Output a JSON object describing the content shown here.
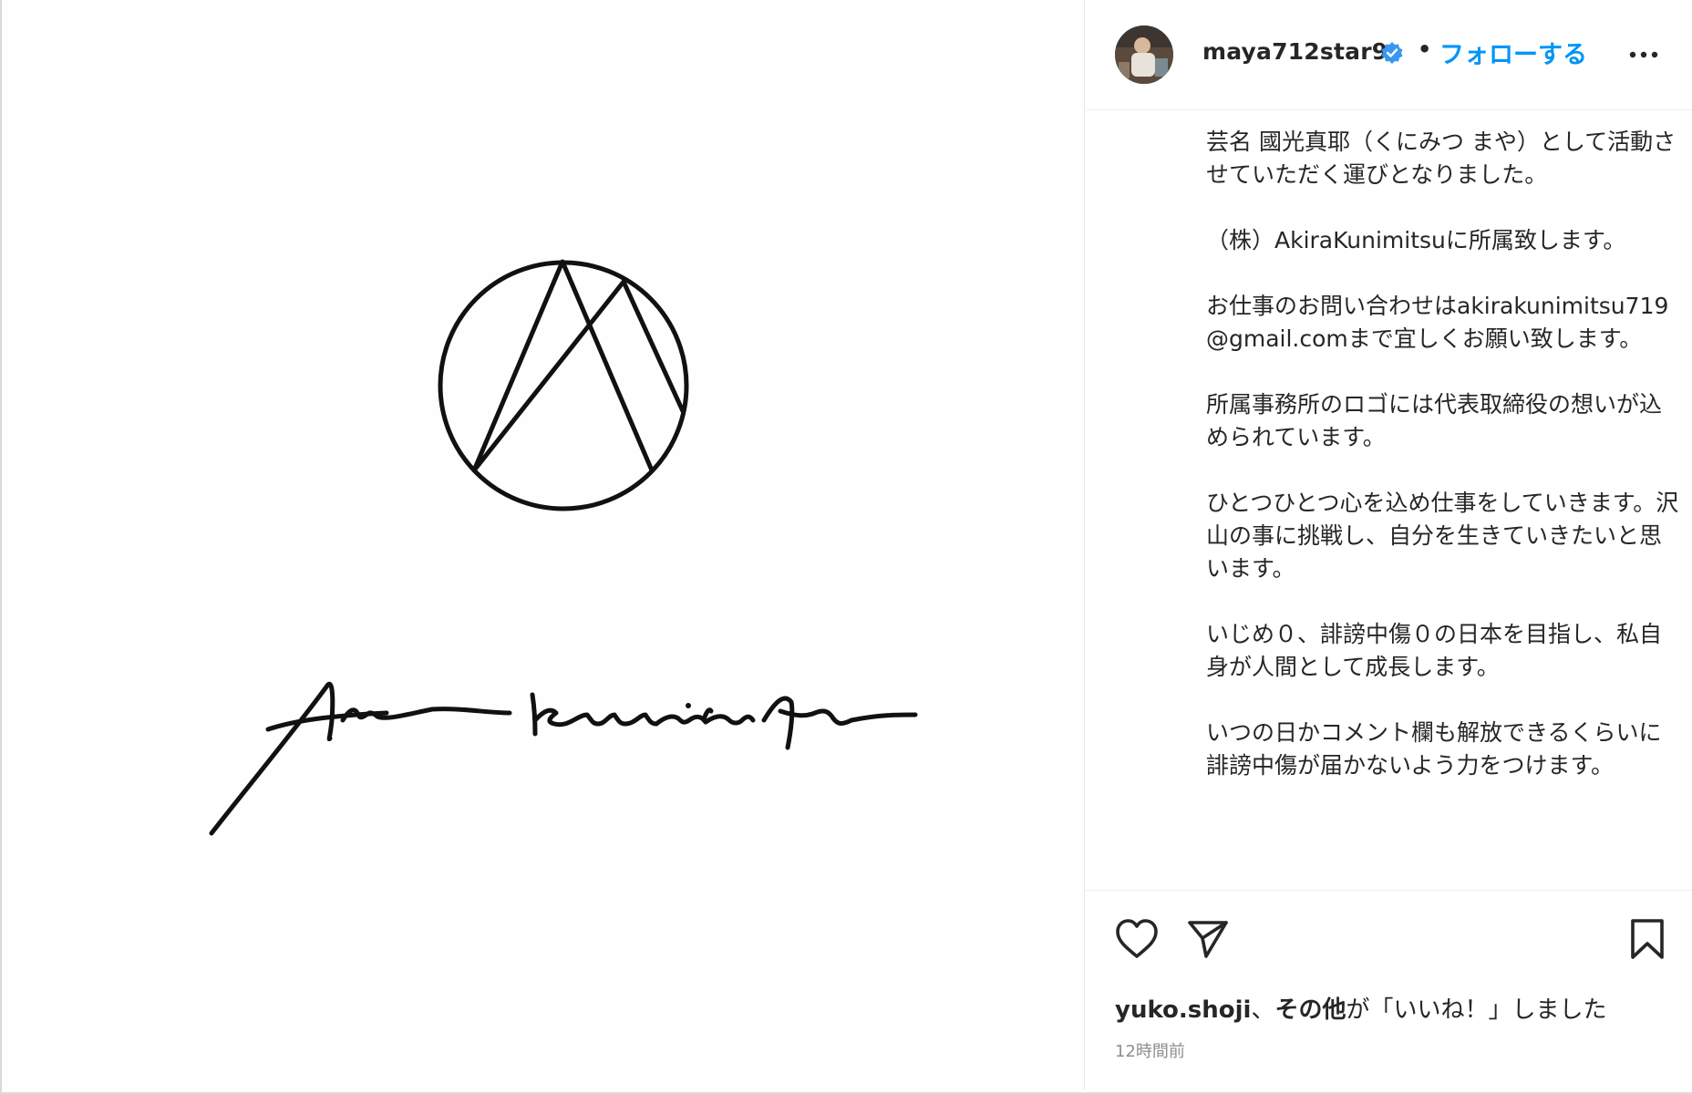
{
  "media": {
    "logo_alt": "AkiraKunimitsu logo",
    "signature_text": "Akira Kunimitsu"
  },
  "header": {
    "username": "maya712star9",
    "separator": "•",
    "follow_label": "フォローする",
    "verified_icon": "verified-badge-icon",
    "more_icon": "more-options-icon"
  },
  "caption": {
    "paragraphs": [
      "芸名 國光真耶（くにみつ まや）として活動させていただく運びとなりました。",
      "（株）AkiraKunimitsuに所属致します。",
      "お仕事のお問い合わせはakirakunimitsu719@gmail.comまで宜しくお願い致します。",
      "所属事務所のロゴには代表取締役の想いが込められています。",
      "ひとつひとつ心を込め仕事をしていきます。沢山の事に挑戦し、自分を生きていきたいと思います。",
      "いじめ０、誹謗中傷０の日本を目指し、私自身が人間として成長します。",
      "いつの日かコメント欄も解放できるくらいに誹謗中傷が届かないよう力をつけます。"
    ]
  },
  "actions": {
    "like_icon": "heart-icon",
    "share_icon": "paper-plane-icon",
    "save_icon": "bookmark-icon"
  },
  "likes": {
    "user": "yuko.shoji",
    "sep": "、",
    "others": "その他",
    "suffix": "が「いいね！」しました"
  },
  "timestamp": "12時間前",
  "colors": {
    "follow": "#0095f6",
    "verified": "#3897f0",
    "text": "#262626",
    "muted": "#8e8e8e"
  }
}
